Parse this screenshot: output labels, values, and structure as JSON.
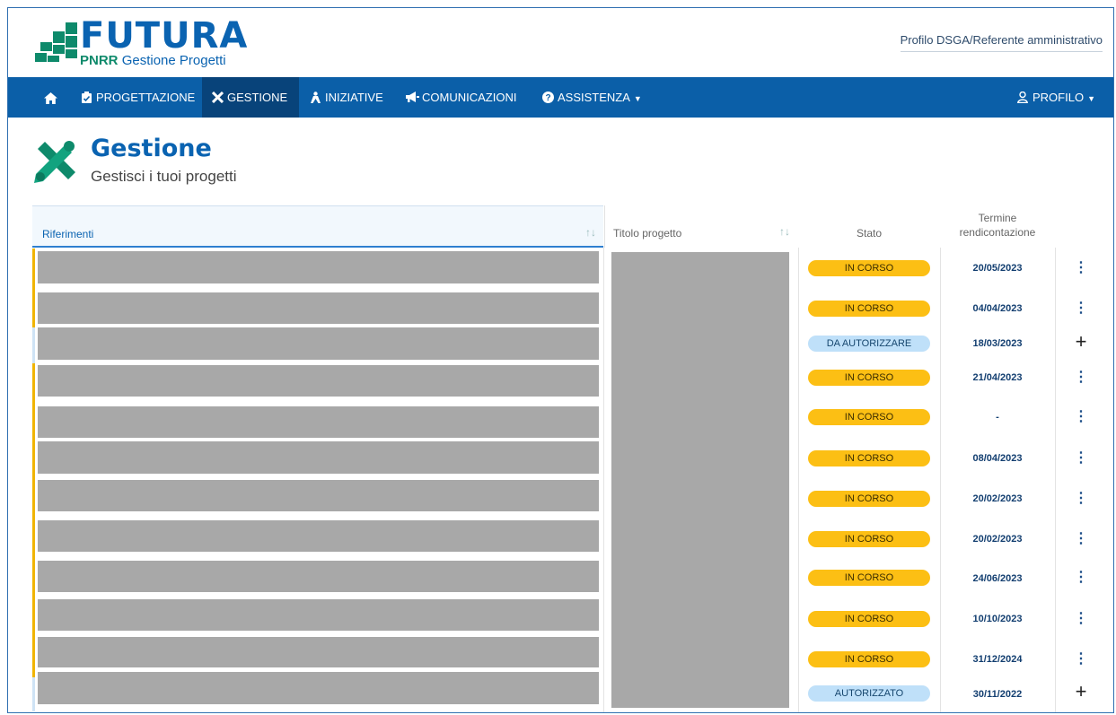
{
  "header": {
    "logo_word": "FUTURA",
    "logo_pnrr": "PNRR",
    "logo_sub": "Gestione Progetti",
    "profile_label": "Profilo DSGA/Referente amministrativo"
  },
  "nav": {
    "home_icon": "home-icon",
    "items": [
      {
        "label": "PROGETTAZIONE",
        "icon": "clipboard-icon"
      },
      {
        "label": "GESTIONE",
        "icon": "tools-icon"
      },
      {
        "label": "INIZIATIVE",
        "icon": "person-icon"
      },
      {
        "label": "COMUNICAZIONI",
        "icon": "megaphone-icon"
      },
      {
        "label": "ASSISTENZA",
        "icon": "question-icon"
      }
    ],
    "profile": "PROFILO"
  },
  "page": {
    "title": "Gestione",
    "subtitle": "Gestisci i tuoi progetti"
  },
  "table": {
    "headers": {
      "riferimenti": "Riferimenti",
      "titolo": "Titolo progetto",
      "stato": "Stato",
      "termine_1": "Termine",
      "termine_2": "rendicontazione"
    },
    "rows": [
      {
        "stato": "IN CORSO",
        "termine": "20/05/2023",
        "azione": "kebab"
      },
      {
        "stato": "IN CORSO",
        "termine": "04/04/2023",
        "azione": "kebab"
      },
      {
        "stato": "DA AUTORIZZARE",
        "termine": "18/03/2023",
        "azione": "plus"
      },
      {
        "stato": "IN CORSO",
        "termine": "21/04/2023",
        "azione": "kebab"
      },
      {
        "stato": "IN CORSO",
        "termine": "-",
        "azione": "kebab"
      },
      {
        "stato": "IN CORSO",
        "termine": "08/04/2023",
        "azione": "kebab"
      },
      {
        "stato": "IN CORSO",
        "termine": "20/02/2023",
        "azione": "kebab"
      },
      {
        "stato": "IN CORSO",
        "termine": "20/02/2023",
        "azione": "kebab"
      },
      {
        "stato": "IN CORSO",
        "termine": "24/06/2023",
        "azione": "kebab"
      },
      {
        "stato": "IN CORSO",
        "termine": "10/10/2023",
        "azione": "kebab"
      },
      {
        "stato": "IN CORSO",
        "termine": "31/12/2024",
        "azione": "kebab"
      },
      {
        "stato": "AUTORIZZATO",
        "termine": "30/11/2022",
        "azione": "plus"
      }
    ]
  },
  "colors": {
    "primary": "#0b5fa8",
    "active_nav": "#08437a",
    "brand_green": "#0e8a6b",
    "in_corso": "#fcbf14",
    "autorizzare": "#bfe0f9"
  }
}
